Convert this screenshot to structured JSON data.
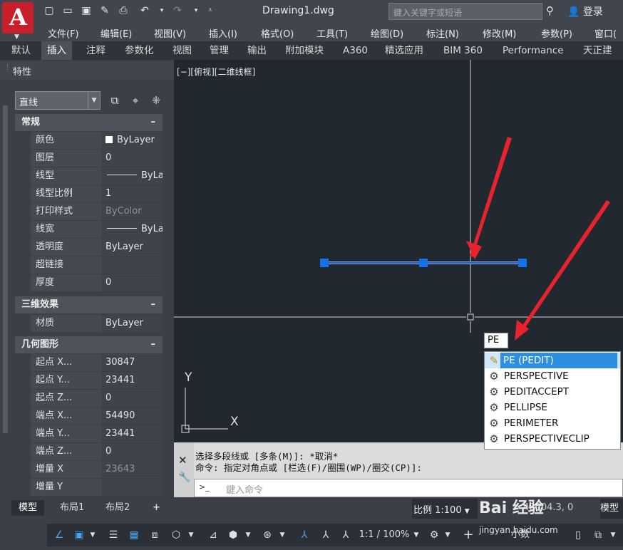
{
  "title_bar": {
    "app_logo_letter": "A",
    "doc_title": "Drawing1.dwg",
    "search_placeholder": "鍵入关键字或短语",
    "login_label": "登录"
  },
  "menu": [
    "文件(F)",
    "编辑(E)",
    "视图(V)",
    "插入(I)",
    "格式(O)",
    "工具(T)",
    "绘图(D)",
    "标注(N)",
    "修改(M)",
    "参数(P)",
    "窗口("
  ],
  "ribbon_tabs": [
    {
      "label": "默认",
      "active": false
    },
    {
      "label": "插入",
      "active": true
    },
    {
      "label": "注释",
      "active": false
    },
    {
      "label": "参数化",
      "active": false
    },
    {
      "label": "视图",
      "active": false
    },
    {
      "label": "管理",
      "active": false
    },
    {
      "label": "输出",
      "active": false
    },
    {
      "label": "附加模块",
      "active": false
    },
    {
      "label": "A360",
      "active": false
    },
    {
      "label": "精选应用",
      "active": false
    },
    {
      "label": "BIM 360",
      "active": false
    },
    {
      "label": "Performance",
      "active": false
    },
    {
      "label": "天正建筑",
      "active": false
    }
  ],
  "palette": {
    "title": "特性",
    "object_type": "直线",
    "sections": {
      "general": {
        "title": "常规",
        "rows": [
          {
            "key": "颜色",
            "value": "ByLayer"
          },
          {
            "key": "图层",
            "value": "0"
          },
          {
            "key": "线型",
            "value": "ByLa..."
          },
          {
            "key": "线型比例",
            "value": "1"
          },
          {
            "key": "打印样式",
            "value": "ByColor"
          },
          {
            "key": "线宽",
            "value": "ByLa..."
          },
          {
            "key": "透明度",
            "value": "ByLayer"
          },
          {
            "key": "超链接",
            "value": ""
          },
          {
            "key": "厚度",
            "value": "0"
          }
        ]
      },
      "threed": {
        "title": "三维效果",
        "rows": [
          {
            "key": "材质",
            "value": "ByLayer"
          }
        ]
      },
      "geometry": {
        "title": "几何图形",
        "rows": [
          {
            "key": "起点 X...",
            "value": "30847"
          },
          {
            "key": "起点 Y...",
            "value": "23441"
          },
          {
            "key": "起点 Z...",
            "value": "0"
          },
          {
            "key": "端点 X...",
            "value": "54490"
          },
          {
            "key": "端点 Y...",
            "value": "23441"
          },
          {
            "key": "端点 Z...",
            "value": "0"
          },
          {
            "key": "增量 X",
            "value": "23643"
          },
          {
            "key": "增量 Y",
            "value": ""
          }
        ]
      }
    },
    "collapse_symbol": "–"
  },
  "viewport": {
    "label": "[−][俯视][二维线框]",
    "ucs_x": "X",
    "ucs_y": "Y"
  },
  "autocomplete": {
    "typed": "PE",
    "items": [
      {
        "label": "PE (PEDIT)",
        "selected": true,
        "icon": "pencil-icon"
      },
      {
        "label": "PERSPECTIVE",
        "selected": false,
        "icon": "gear-icon"
      },
      {
        "label": "PEDITACCEPT",
        "selected": false,
        "icon": "gear-icon"
      },
      {
        "label": "PELLIPSE",
        "selected": false,
        "icon": "gear-icon"
      },
      {
        "label": "PERIMETER",
        "selected": false,
        "icon": "gear-icon"
      },
      {
        "label": "PERSPECTIVECLIP",
        "selected": false,
        "icon": "gear-icon"
      }
    ]
  },
  "command": {
    "history_1": "选择多段线或 [多条(M)]: *取消*",
    "history_2": "命令: 指定对角点或 [栏选(F)/圈围(WP)/圈交(CP)]:",
    "input_placeholder": "鍵入命令",
    "prompt_symbol": ">_"
  },
  "layout_tabs": [
    {
      "label": "模型",
      "active": true
    },
    {
      "label": "布局1",
      "active": false
    },
    {
      "label": "布局2",
      "active": false
    },
    {
      "label": "+",
      "active": false
    }
  ],
  "status": {
    "scale": "比例 1:100",
    "annot_scale": "1:1 / 100%",
    "model_label": "模型",
    "decimal": "小数",
    "coord_readout": "48004.3, 0",
    "coord_tail": "0"
  },
  "watermark": {
    "text": "Bai 经验",
    "sub": "jingyan.baidu.com"
  },
  "colors": {
    "canvas": "#212830",
    "selected_line": "#3b7ad9",
    "grip": "#1670e8",
    "arrow": "#e8232d",
    "crosshair": "#d8d8d8"
  }
}
